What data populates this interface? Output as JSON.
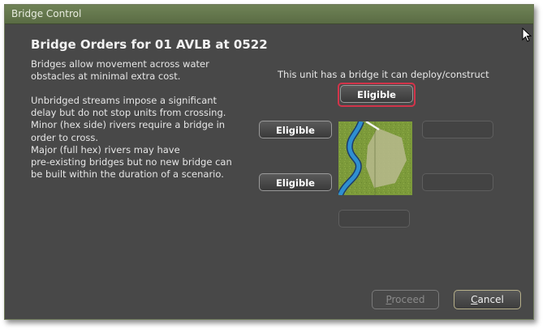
{
  "window": {
    "title": "Bridge Control"
  },
  "heading": "Bridge Orders for 01 AVLB at 0522",
  "description": {
    "paragraph1": "Bridges allow movement across water\nobstacles at minimal extra cost.",
    "paragraph2": "Unbridged streams impose a significant\ndelay but do not stop units from crossing.\nMinor (hex side) rivers require a bridge in\norder to cross.\nMajor (full hex) rivers may have\npre-existing bridges but no new bridge can\nbe built within the duration of a scenario."
  },
  "deploy_info": "This unit has a bridge it can deploy/construct",
  "hex_buttons": {
    "top": "Eligible",
    "upper_left": "Eligible",
    "lower_left": "Eligible",
    "upper_right": "",
    "lower_right": "",
    "bottom": ""
  },
  "footer": {
    "proceed_mnemonic": "P",
    "proceed_rest": "roceed",
    "cancel_mnemonic": "C",
    "cancel_rest": "ancel"
  },
  "colors": {
    "dialog_bg": "#484848",
    "titlebar": "#6a7d50",
    "focus_ring": "#d2344a",
    "river": "#2f8fd0",
    "terrain": "#7c9a3a"
  }
}
